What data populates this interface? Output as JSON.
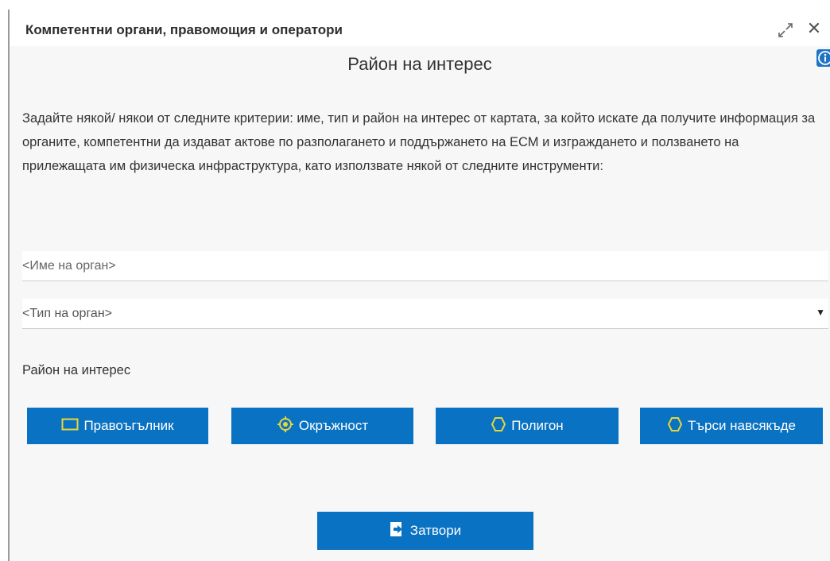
{
  "window": {
    "title": "Компетентни органи, правомощия и оператори",
    "expand_icon": "expand-icon",
    "close_icon": "close-icon",
    "close_glyph": "✕"
  },
  "panel": {
    "heading": "Район на интерес",
    "info_icon": "info-icon",
    "description": "Задайте някой/ някои от следните критерии: име, тип и район на интерес от картата, за който искате да получите информация за органите, компетентни да издават актове по разполагането и поддържането на ЕСМ и изграждането и ползването на прилежащата им физическа инфраструктура, като използвате някой от следните инструменти:"
  },
  "form": {
    "name_input": {
      "value": "",
      "placeholder": "<Име на орган>"
    },
    "type_select": {
      "selected": "<Тип на орган>",
      "arrow": "▼"
    },
    "area_label": "Район на интерес"
  },
  "tools": [
    {
      "label": "Правоъгълник",
      "icon": "rectangle-icon"
    },
    {
      "label": "Окръжност",
      "icon": "circle-target-icon"
    },
    {
      "label": "Полигон",
      "icon": "polygon-icon"
    },
    {
      "label": "Търси навсякъде",
      "icon": "polygon-icon"
    }
  ],
  "footer": {
    "close_label": "Затвори",
    "close_icon": "exit-icon"
  },
  "colors": {
    "button_blue": "#0a72c2",
    "icon_yellow": "#e6d63a",
    "content_bg": "#f7f7f7",
    "info_blue": "#1e74c4"
  }
}
